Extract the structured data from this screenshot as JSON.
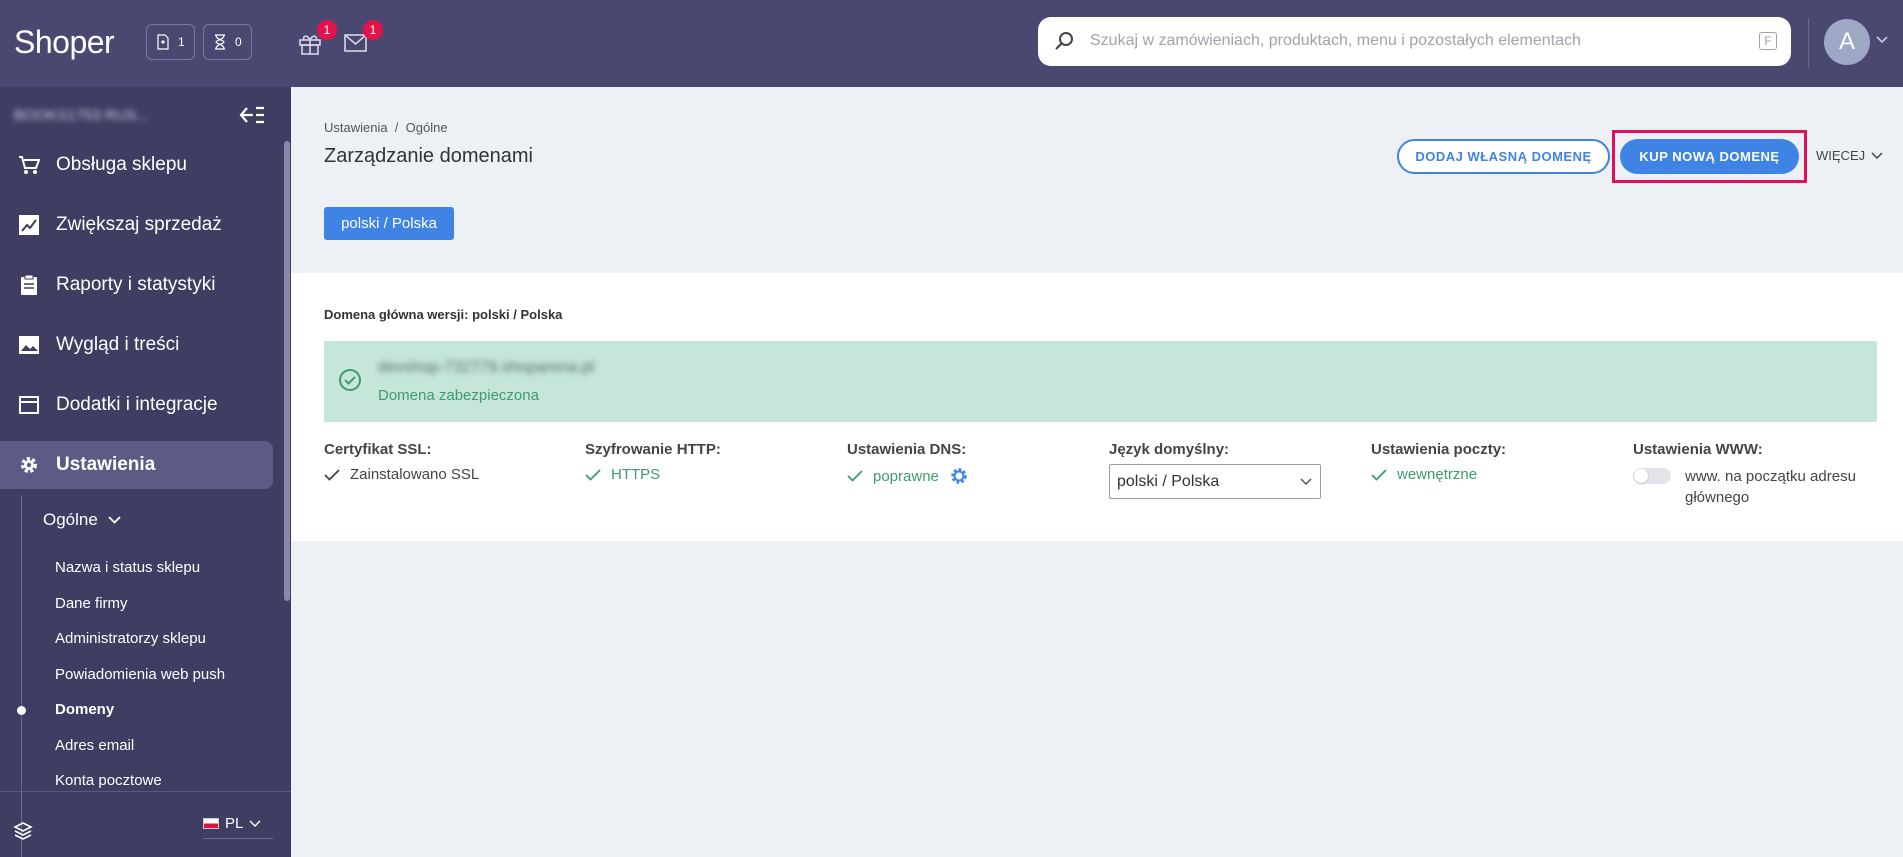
{
  "topbar": {
    "logo": "Shoper",
    "counter_orders": "1",
    "counter_pending": "0",
    "gift_badge": "1",
    "mail_badge": "1",
    "search_placeholder": "Szukaj w zamówieniach, produktach, menu i pozostałych elementach",
    "search_shortcut": "F",
    "avatar_letter": "A"
  },
  "sidebar": {
    "shop_name": "BOOKS1753 RUS...",
    "items": [
      {
        "label": "Obsługa sklepu",
        "icon": "cart-icon"
      },
      {
        "label": "Zwiększaj sprzedaż",
        "icon": "chart-icon"
      },
      {
        "label": "Raporty i statystyki",
        "icon": "clipboard-icon"
      },
      {
        "label": "Wygląd i treści",
        "icon": "image-icon"
      },
      {
        "label": "Dodatki i integracje",
        "icon": "window-icon"
      },
      {
        "label": "Ustawienia",
        "icon": "gear-icon"
      }
    ],
    "submenu_head": "Ogólne",
    "subitems": [
      "Nazwa i status sklepu",
      "Dane firmy",
      "Administratorzy sklepu",
      "Powiadomienia web push",
      "Domeny",
      "Adres email",
      "Konta pocztowe"
    ],
    "language": "PL"
  },
  "page": {
    "breadcrumb": "Ustawienia  /  Ogólne",
    "title": "Zarządzanie domenami",
    "btn_add_domain": "DODAJ WŁASNĄ DOMENĘ",
    "btn_buy_domain": "KUP NOWĄ DOMENĘ",
    "more": "WIĘCEJ",
    "lang_tab": "polski / Polska"
  },
  "panel": {
    "label": "Domena główna wersji: polski / Polska",
    "domain_name": "devshop-732779.shoparena.pl",
    "domain_status": "Domena zabezpieczona",
    "ssl_label": "Certyfikat SSL:",
    "ssl_value": "Zainstalowano SSL",
    "http_label": "Szyfrowanie HTTP:",
    "http_value": "HTTPS",
    "dns_label": "Ustawienia DNS:",
    "dns_value": "poprawne",
    "lang_label": "Język domyślny:",
    "lang_value": "polski / Polska",
    "mail_label": "Ustawienia poczty:",
    "mail_value": "wewnętrzne",
    "www_label": "Ustawienia WWW:",
    "www_value": "www. na początku adresu głównego"
  },
  "colors": {
    "topbar": "#4a4771",
    "sidebar": "#3f3d62",
    "accent": "#3f84e5",
    "highlight": "#e2105a",
    "success_bg": "#c5e6d8",
    "success_text": "#3e9c6d"
  }
}
